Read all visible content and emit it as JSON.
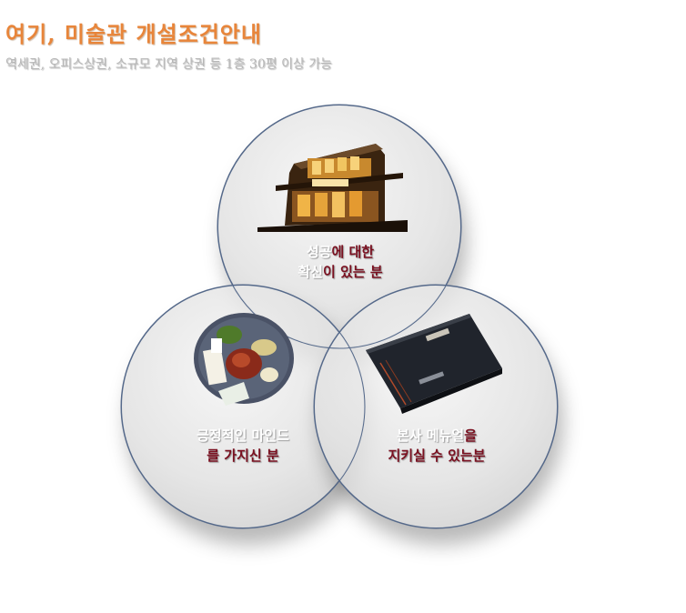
{
  "header": {
    "title": "여기, 미술관 개설조건안내",
    "subtitle": "역세권, 오피스상권, 소규모 지역 상권 등 1층 30평 이상 가능"
  },
  "circles": {
    "top": {
      "line1_white": "성공",
      "line1_red": "에 대한",
      "line2_white": "확신",
      "line2_red": "이 있는 분"
    },
    "left": {
      "line1_white": "긍정적인 마인드",
      "line2_red": "를 가지신 분"
    },
    "right": {
      "line1_white": "본사 메뉴얼",
      "line1_red": "을",
      "line2_red": "지키실 수 있는분"
    }
  },
  "colors": {
    "title": "#e8853a",
    "accent_red": "#7a1020",
    "circle_border": "#55698a"
  },
  "images": {
    "top": "restaurant-building-photo",
    "left": "food-plate-photo",
    "right": "menu-book-photo"
  }
}
